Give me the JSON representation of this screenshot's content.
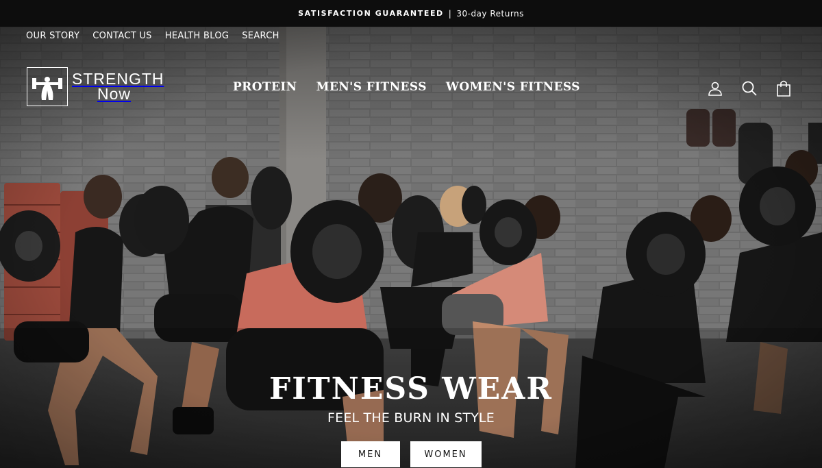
{
  "announcement": {
    "highlight": "SATISFACTION GUARANTEED",
    "separator": "|",
    "text": "30-day Returns"
  },
  "utility_nav": [
    "OUR STORY",
    "CONTACT US",
    "HEALTH BLOG",
    "SEARCH"
  ],
  "logo": {
    "line1": "STRENGTH",
    "line2": "NOW",
    "line2_display": "Now"
  },
  "main_nav": [
    "PROTEIN",
    "MEN'S FITNESS",
    "WOMEN'S FITNESS"
  ],
  "icons": [
    "account-icon",
    "search-icon",
    "cart-icon"
  ],
  "hero": {
    "title": "FITNESS WEAR",
    "subtitle": "FEEL THE BURN IN STYLE",
    "buttons": {
      "men": "MEN",
      "women": "WOMEN"
    }
  },
  "colors": {
    "announcement_bg": "#0d0d0d",
    "text": "#ffffff",
    "button_bg": "#ffffff",
    "button_text": "#111111",
    "accent_tank": "#c86b5c"
  }
}
